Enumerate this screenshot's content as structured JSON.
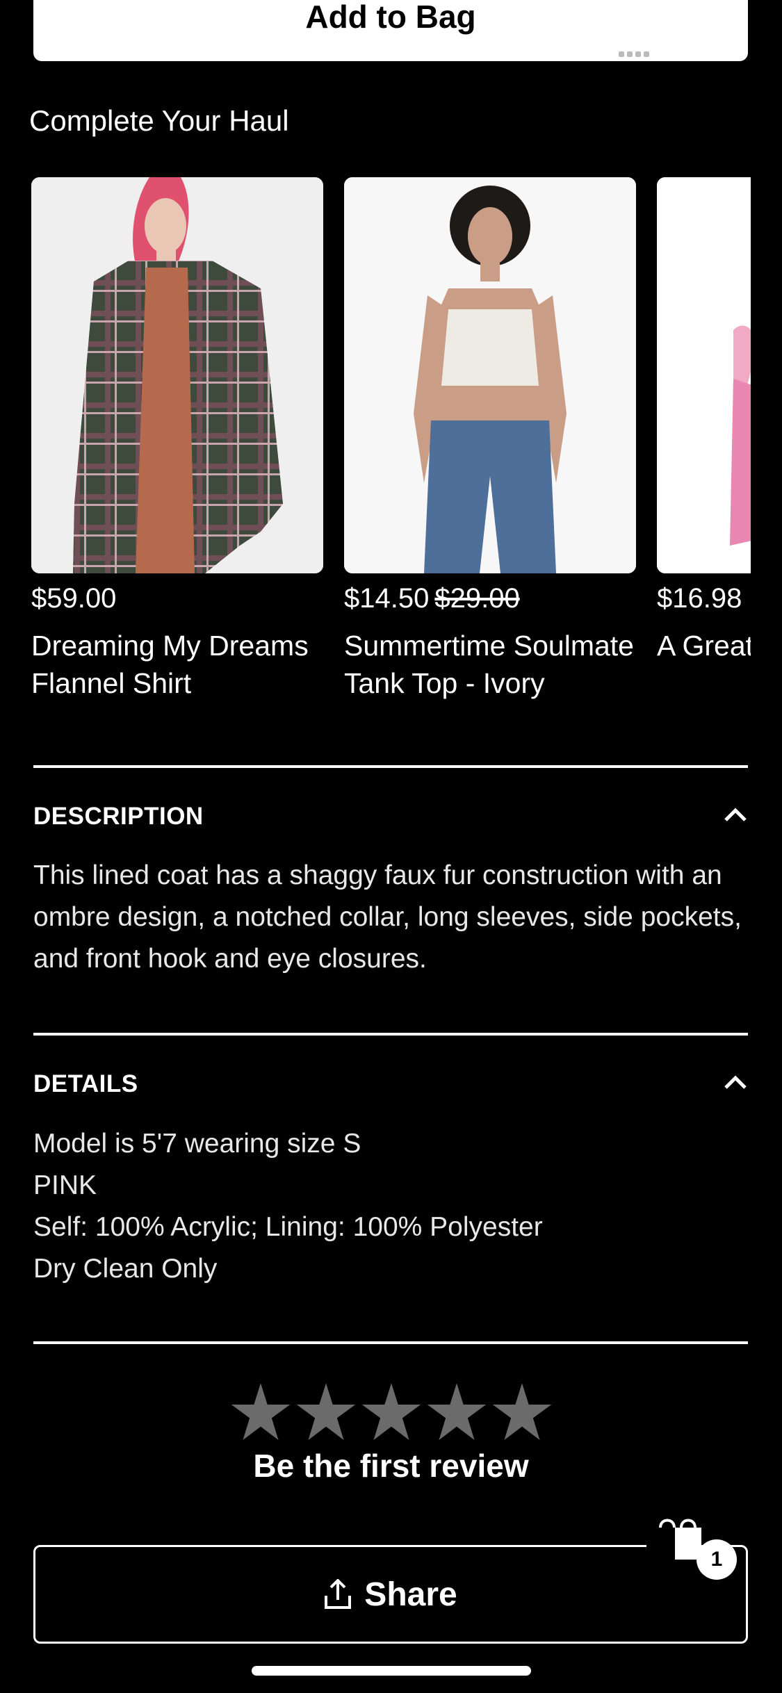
{
  "add_to_bag": {
    "label": "Add to Bag"
  },
  "haul": {
    "title": "Complete Your Haul",
    "products": [
      {
        "price": "$59.00",
        "original_price": "",
        "name": "Dreaming My Dreams Flannel Shirt"
      },
      {
        "price": "$14.50",
        "original_price": "$29.00",
        "name": "Summertime Soulmate Tank Top - Ivory"
      },
      {
        "price": "$16.98",
        "original_price": "",
        "name": "A Great Top"
      }
    ]
  },
  "description": {
    "heading": "DESCRIPTION",
    "text": "This lined coat has a shaggy faux fur construction with an ombre design, a notched collar, long sleeves, side pockets, and front hook and eye closures."
  },
  "details": {
    "heading": "DETAILS",
    "items": [
      "Model is 5'7 wearing size S",
      "PINK",
      "Self: 100% Acrylic; Lining: 100% Polyester",
      "Dry Clean Only"
    ]
  },
  "reviews": {
    "label": "Be the first review",
    "rating": 0,
    "max_rating": 5
  },
  "share": {
    "label": "Share"
  },
  "bag": {
    "count": "1"
  },
  "colors": {
    "background": "#000000",
    "foreground": "#ffffff",
    "star": "#6b6b6b"
  }
}
